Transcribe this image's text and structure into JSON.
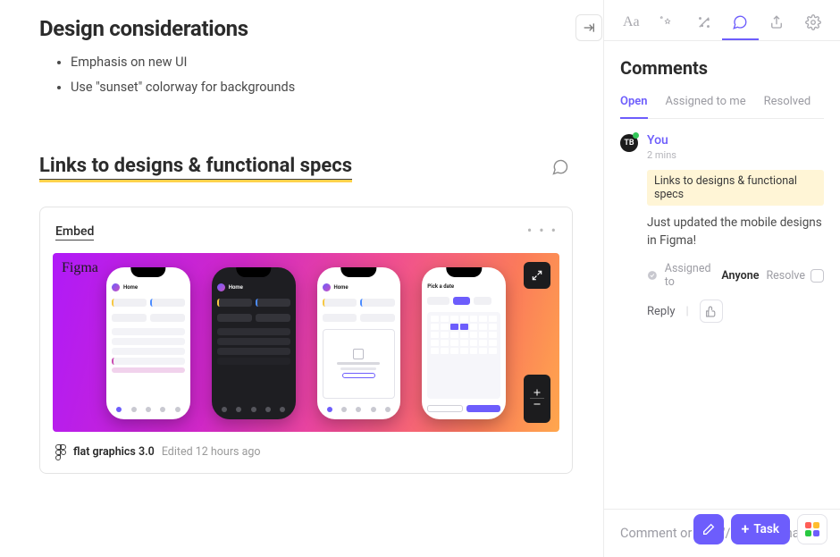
{
  "main": {
    "top_heading": "Design considerations",
    "bullets": [
      "Emphasis on new UI",
      "Use \"sunset\" colorway for backgrounds"
    ],
    "section_heading": "Links to designs & functional specs",
    "embed": {
      "label": "Embed",
      "figma_badge": "Figma",
      "file_name": "flat graphics 3.0",
      "edited": "Edited 12 hours ago"
    }
  },
  "sidebar": {
    "panel_title": "Comments",
    "tabs": {
      "open": "Open",
      "assigned": "Assigned to me",
      "resolved": "Resolved"
    },
    "commenter_initials": "TB",
    "author": "You",
    "time": "2 mins",
    "ref": "Links to designs & functional specs",
    "body": "Just updated the mobile designs in Figma!",
    "assigned_label": "Assigned to",
    "assignee": "Anyone",
    "resolve": "Resolve",
    "reply": "Reply",
    "input_placeholder": "Comment or type '/' for commands",
    "fab_task": "Task"
  }
}
